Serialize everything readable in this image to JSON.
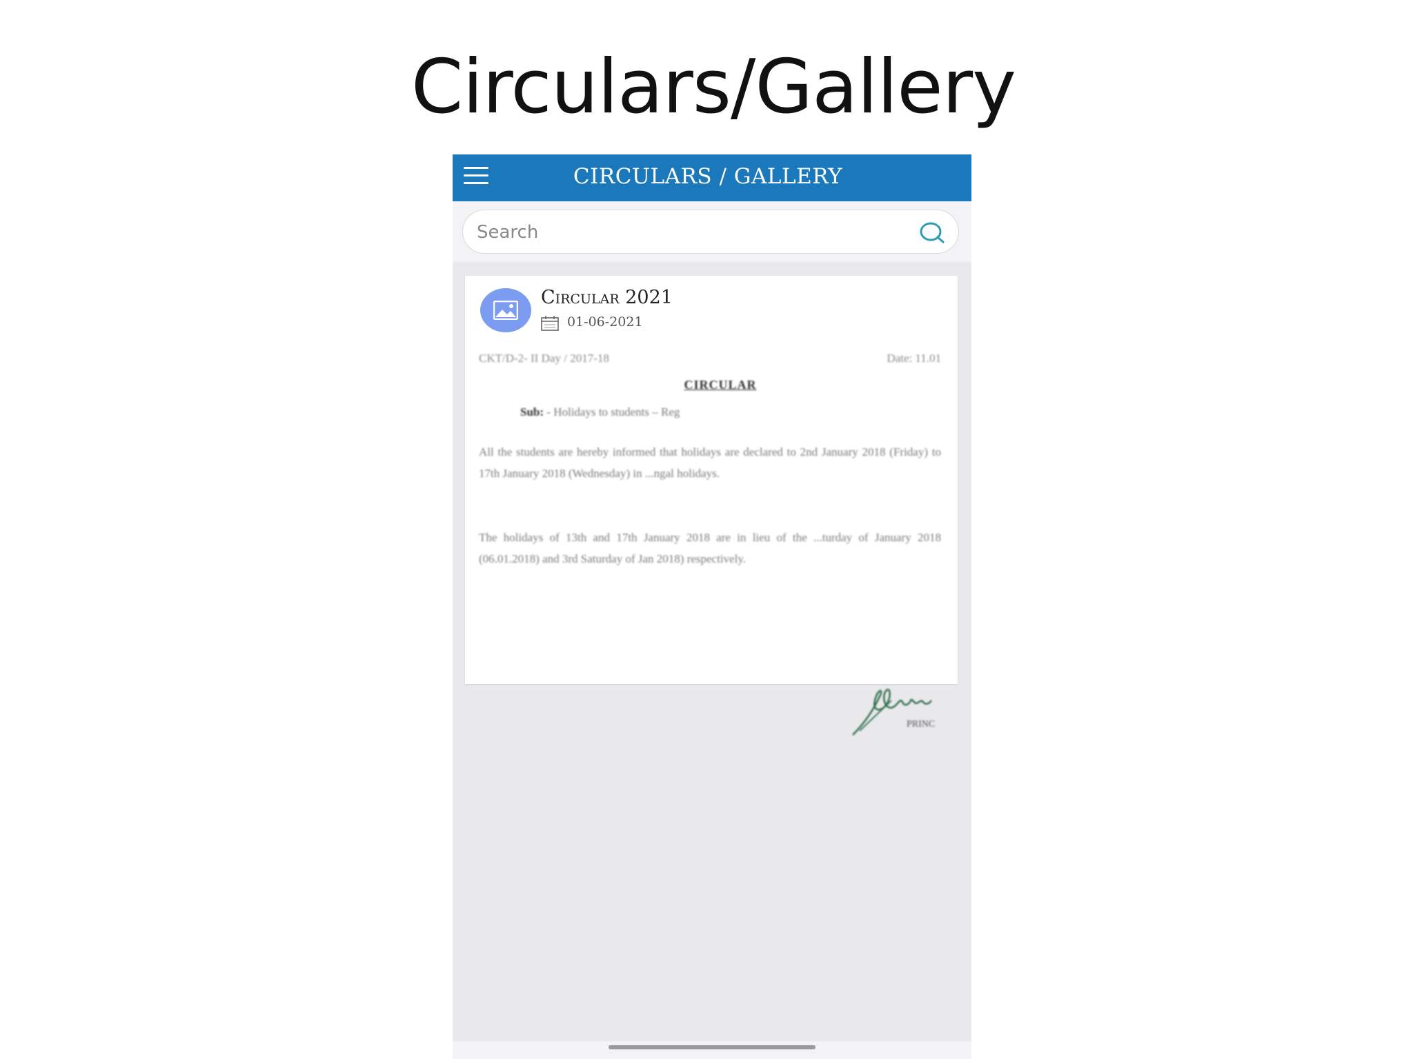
{
  "slide": {
    "title": "Circulars/Gallery"
  },
  "app": {
    "header_title": "CIRCULARS / GALLERY",
    "search": {
      "placeholder": "Search"
    }
  },
  "circular": {
    "title": "Circular 2021",
    "date": "01-06-2021",
    "document": {
      "ref": "CKT/D-2- II Day / 2017-18",
      "date": "Date: 11.01",
      "heading": "CIRCULAR",
      "subject_label": "Sub:",
      "subject_text": "- Holidays to students – Reg",
      "para1": "All the students are hereby informed that holidays are declared to 2nd January 2018 (Friday) to 17th January 2018 (Wednesday) in ...ngal holidays.",
      "para2": "The holidays of 13th and 17th January 2018 are in lieu of the ...turday of January 2018 (06.01.2018) and 3rd Saturday of Jan 2018) respectively.",
      "signature_caption": "PRINC"
    }
  },
  "colors": {
    "app_bar": "#1a78bb",
    "avatar": "#7b9cf0",
    "search_icon": "#2e9ab8",
    "background": "#e9e9ec"
  },
  "icons": [
    "menu-icon",
    "search-icon",
    "image-icon",
    "calendar-icon"
  ]
}
